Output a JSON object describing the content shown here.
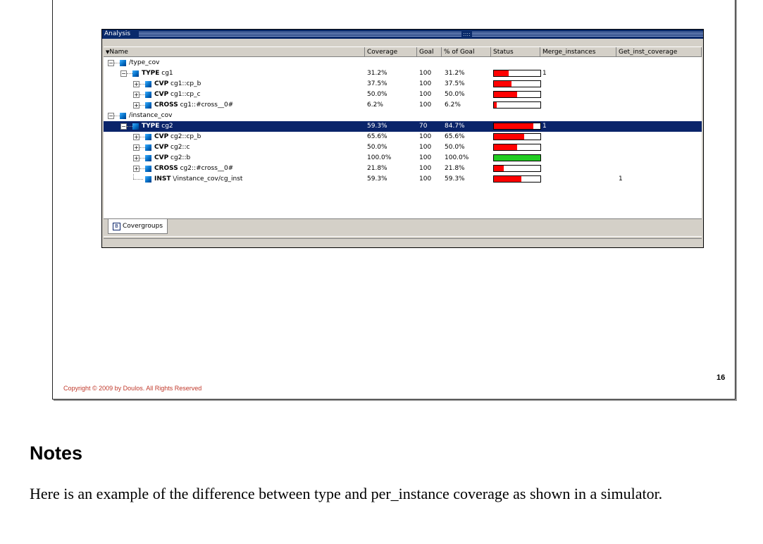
{
  "window": {
    "title": "Analysis",
    "grip": "::::"
  },
  "columns": [
    "Name",
    "Coverage",
    "Goal",
    "% of Goal",
    "Status",
    "Merge_instances",
    "Get_inst_coverage"
  ],
  "rows": [
    {
      "kind": "",
      "name": "/type_cov",
      "coverage": "",
      "goal": "",
      "pct": "",
      "bar": null,
      "merge": "",
      "getinst": ""
    },
    {
      "kind": "TYPE",
      "name": " cg1",
      "coverage": "31.2%",
      "goal": "100",
      "pct": "31.2%",
      "bar": 0.312,
      "merge": "1",
      "getinst": ""
    },
    {
      "kind": "CVP",
      "name": " cg1::cp_b",
      "coverage": "37.5%",
      "goal": "100",
      "pct": "37.5%",
      "bar": 0.375,
      "merge": "",
      "getinst": ""
    },
    {
      "kind": "CVP",
      "name": " cg1::cp_c",
      "coverage": "50.0%",
      "goal": "100",
      "pct": "50.0%",
      "bar": 0.5,
      "merge": "",
      "getinst": ""
    },
    {
      "kind": "CROSS",
      "name": " cg1::#cross__0#",
      "coverage": "6.2%",
      "goal": "100",
      "pct": "6.2%",
      "bar": 0.062,
      "merge": "",
      "getinst": ""
    },
    {
      "kind": "",
      "name": "/instance_cov",
      "coverage": "",
      "goal": "",
      "pct": "",
      "bar": null,
      "merge": "",
      "getinst": ""
    },
    {
      "kind": "TYPE",
      "name": " cg2",
      "coverage": "59.3%",
      "goal": "70",
      "pct": "84.7%",
      "bar": 0.847,
      "merge": "1",
      "getinst": ""
    },
    {
      "kind": "CVP",
      "name": " cg2::cp_b",
      "coverage": "65.6%",
      "goal": "100",
      "pct": "65.6%",
      "bar": 0.656,
      "merge": "",
      "getinst": ""
    },
    {
      "kind": "CVP",
      "name": " cg2::c",
      "coverage": "50.0%",
      "goal": "100",
      "pct": "50.0%",
      "bar": 0.5,
      "merge": "",
      "getinst": ""
    },
    {
      "kind": "CVP",
      "name": " cg2::b",
      "coverage": "100.0%",
      "goal": "100",
      "pct": "100.0%",
      "bar": 1.0,
      "merge": "",
      "getinst": ""
    },
    {
      "kind": "CROSS",
      "name": " cg2::#cross__0#",
      "coverage": "21.8%",
      "goal": "100",
      "pct": "21.8%",
      "bar": 0.218,
      "merge": "",
      "getinst": ""
    },
    {
      "kind": "INST",
      "name": " \\/instance_cov/cg_inst",
      "coverage": "59.3%",
      "goal": "100",
      "pct": "59.3%",
      "bar": 0.593,
      "merge": "",
      "getinst": "1"
    }
  ],
  "tab": {
    "icon": "B",
    "label": "Covergroups"
  },
  "footer": {
    "copyright": "Copyright © 2009 by Doulos. All Rights Reserved",
    "page": "16"
  },
  "notes": {
    "heading": "Notes",
    "body": "Here is an example of the difference between type and per_instance coverage as shown in a simulator."
  },
  "colors": {
    "bar_fill": "#ff0000",
    "bar_full": "#22cc22",
    "selection": "#0a246a"
  }
}
